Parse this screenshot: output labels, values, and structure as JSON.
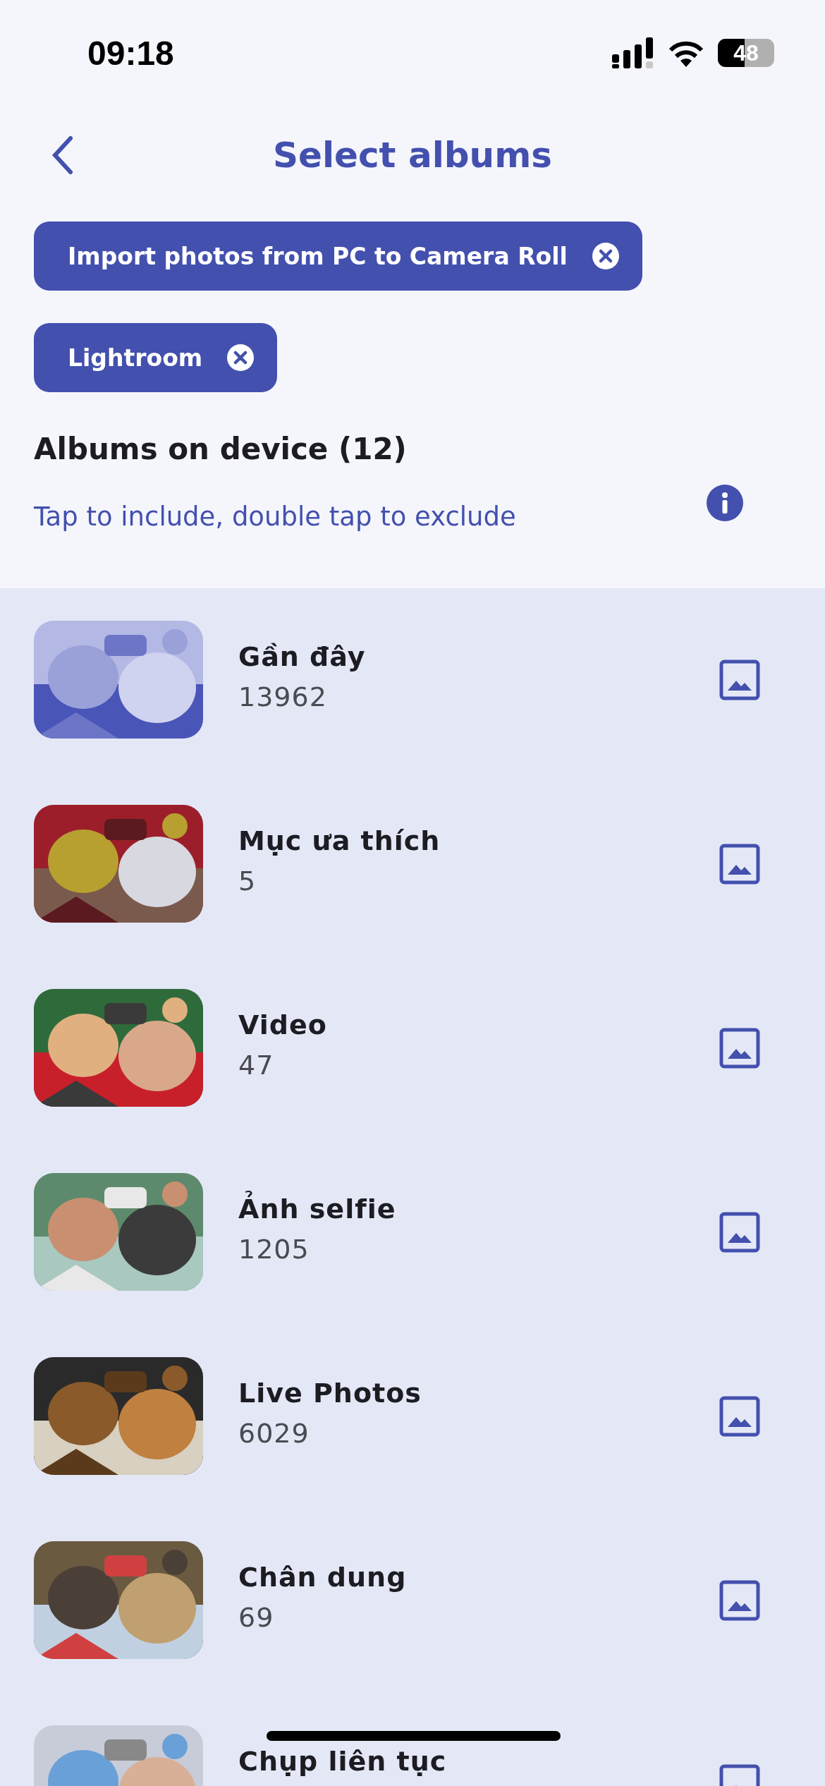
{
  "status_bar": {
    "time": "09:18",
    "battery": "48"
  },
  "header": {
    "title": "Select albums"
  },
  "selected_albums": [
    {
      "label": "Import photos from PC to Camera Roll"
    },
    {
      "label": "Lightroom"
    }
  ],
  "section": {
    "title": "Albums on device (12)",
    "hint": "Tap to include, double tap to exclude"
  },
  "albums": [
    {
      "name": "Gần đây",
      "count": "13962"
    },
    {
      "name": "Mục ưa thích",
      "count": "5"
    },
    {
      "name": "Video",
      "count": "47"
    },
    {
      "name": "Ảnh selfie",
      "count": "1205"
    },
    {
      "name": "Live Photos",
      "count": "6029"
    },
    {
      "name": "Chân dung",
      "count": "69"
    },
    {
      "name": "Chụp liên tục"
    }
  ]
}
